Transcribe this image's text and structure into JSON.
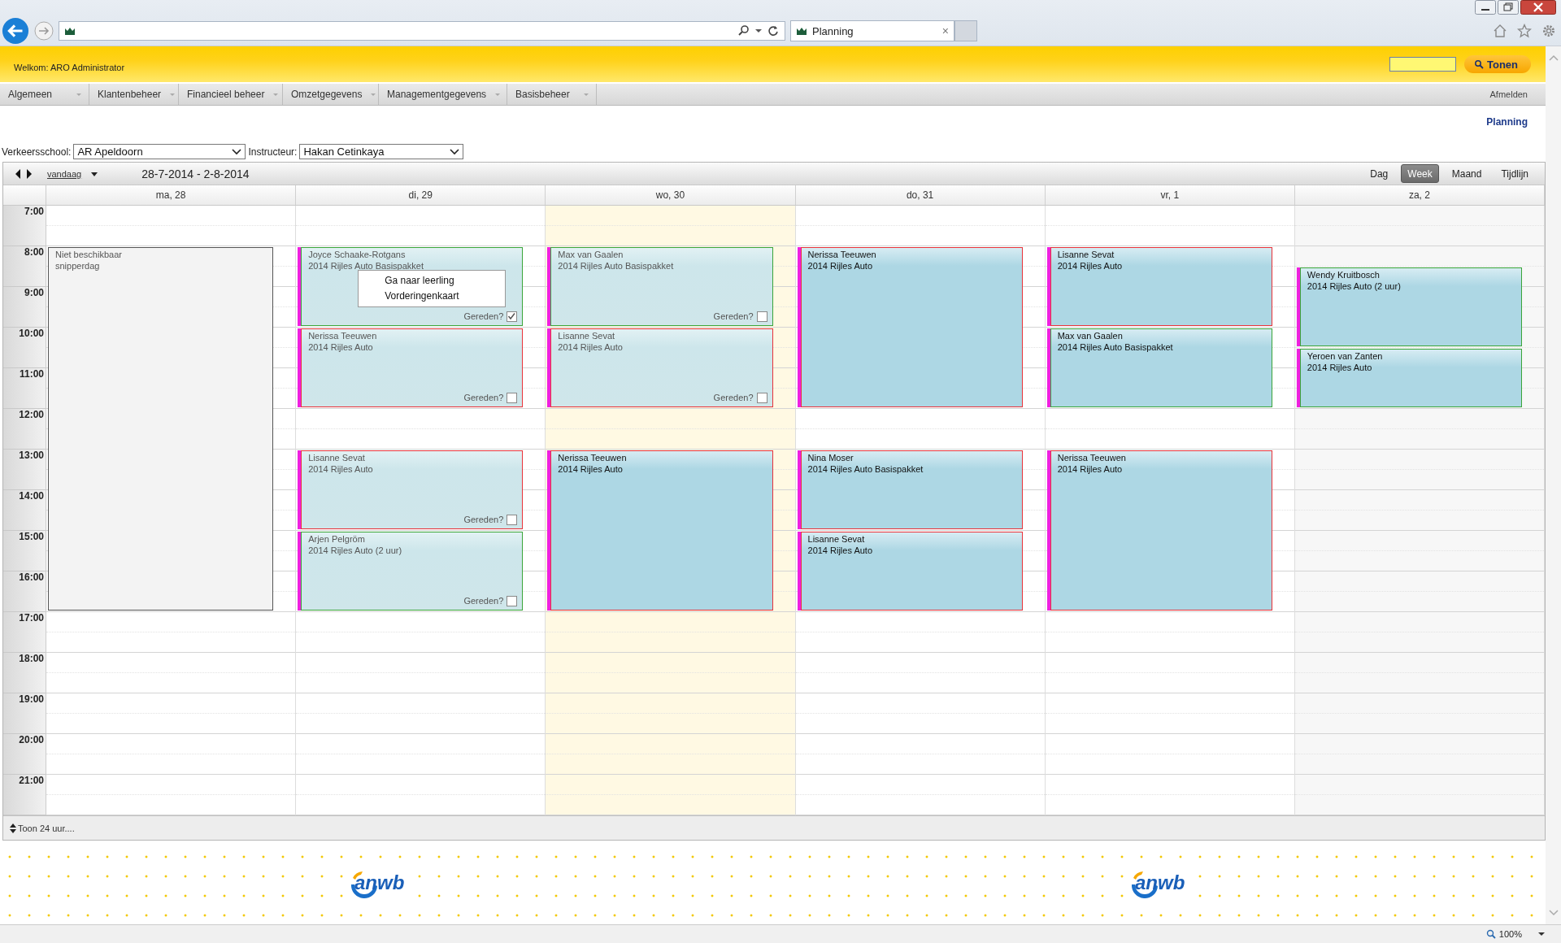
{
  "browser": {
    "tab": {
      "title": "Planning",
      "close": "×"
    },
    "zoom": "100%"
  },
  "header": {
    "welcome": "Welkom: ARO Administrator",
    "search_button": "Tonen"
  },
  "menu": {
    "items": [
      "Algemeen",
      "Klantenbeheer",
      "Financieel beheer",
      "Omzetgegevens",
      "Managementgegevens",
      "Basisbeheer"
    ],
    "logout": "Afmelden"
  },
  "page_title": "Planning",
  "filters": [
    {
      "label": "Verkeersschool:",
      "value": "AR Apeldoorn"
    },
    {
      "label": "Instructeur:",
      "value": "Hakan Cetinkaya"
    }
  ],
  "toolbar": {
    "today": "vandaag",
    "range": "28-7-2014 - 2-8-2014",
    "views": [
      {
        "label": "Dag",
        "selected": false
      },
      {
        "label": "Week",
        "selected": true
      },
      {
        "label": "Maand",
        "selected": false
      },
      {
        "label": "Tijdlijn",
        "selected": false
      }
    ]
  },
  "hours": [
    "7:00",
    "8:00",
    "9:00",
    "10:00",
    "11:00",
    "12:00",
    "13:00",
    "14:00",
    "15:00",
    "16:00",
    "17:00",
    "18:00",
    "19:00",
    "20:00",
    "21:00"
  ],
  "days": [
    {
      "label": "ma, 28",
      "kind": "weekday",
      "events": [
        {
          "kind": "unavailable",
          "title": "Niet beschikbaar",
          "subtitle": "snipperdag"
        }
      ]
    },
    {
      "label": "di, 29",
      "kind": "weekday",
      "events": [
        {
          "kind": "lesson",
          "title": "Joyce Schaake-Rotgans",
          "subtitle": "2014 Rijles Auto Basispakket",
          "color": "#3aa53a",
          "past": true,
          "driven_label": "Gereden?",
          "driven": true
        },
        {
          "kind": "lesson",
          "title": "Nerissa Teeuwen",
          "subtitle": "2014 Rijles Auto",
          "color": "#e8333a",
          "past": true,
          "driven_label": "Gereden?",
          "driven": false
        },
        {
          "kind": "lesson",
          "title": "Lisanne Sevat",
          "subtitle": "2014 Rijles Auto",
          "color": "#e8333a",
          "past": true,
          "driven_label": "Gereden?",
          "driven": false
        },
        {
          "kind": "lesson",
          "title": "Arjen Pelgröm",
          "subtitle": "2014 Rijles Auto (2 uur)",
          "color": "#3aa53a",
          "past": true,
          "driven_label": "Gereden?",
          "driven": false
        }
      ]
    },
    {
      "label": "wo, 30",
      "kind": "today",
      "events": [
        {
          "kind": "lesson",
          "title": "Max van Gaalen",
          "subtitle": "2014 Rijles Auto Basispakket",
          "color": "#3aa53a",
          "past": true,
          "driven_label": "Gereden?",
          "driven": false
        },
        {
          "kind": "lesson",
          "title": "Lisanne Sevat",
          "subtitle": "2014 Rijles Auto",
          "color": "#e8333a",
          "past": true,
          "driven_label": "Gereden?",
          "driven": false
        },
        {
          "kind": "lesson",
          "title": "Nerissa Teeuwen",
          "subtitle": "2014 Rijles Auto",
          "color": "#e8333a",
          "past": false
        }
      ]
    },
    {
      "label": "do, 31",
      "kind": "weekday",
      "events": [
        {
          "kind": "lesson",
          "title": "Nerissa Teeuwen",
          "subtitle": "2014 Rijles Auto",
          "color": "#e8333a",
          "past": false
        },
        {
          "kind": "lesson",
          "title": "Nina Moser",
          "subtitle": "2014 Rijles Auto Basispakket",
          "color": "#e8333a",
          "past": false
        },
        {
          "kind": "lesson",
          "title": "Lisanne Sevat",
          "subtitle": "2014 Rijles Auto",
          "color": "#e8333a",
          "past": false
        }
      ]
    },
    {
      "label": "vr, 1",
      "kind": "weekday",
      "events": [
        {
          "kind": "lesson",
          "title": "Lisanne Sevat",
          "subtitle": "2014 Rijles Auto",
          "color": "#e8333a",
          "past": false
        },
        {
          "kind": "lesson",
          "title": "Max van Gaalen",
          "subtitle": "2014 Rijles Auto Basispakket",
          "color": "#3aa53a",
          "past": false
        },
        {
          "kind": "lesson",
          "title": "Nerissa Teeuwen",
          "subtitle": "2014 Rijles Auto",
          "color": "#e8333a",
          "past": false
        }
      ]
    },
    {
      "label": "za, 2",
      "kind": "weekend",
      "events": [
        {
          "kind": "lesson",
          "title": "Wendy Kruitbosch",
          "subtitle": "2014 Rijles Auto (2 uur)",
          "color": "#3aa53a",
          "past": false
        },
        {
          "kind": "lesson",
          "title": "Yeroen van Zanten",
          "subtitle": "2014 Rijles Auto",
          "color": "#3aa53a",
          "past": false
        }
      ]
    }
  ],
  "context_menu": {
    "items": [
      "Ga naar leerling",
      "Vorderingenkaart"
    ]
  },
  "footer": {
    "toggle": "Toon 24 uur...."
  },
  "logos": [
    "anwb",
    "anwb"
  ]
}
